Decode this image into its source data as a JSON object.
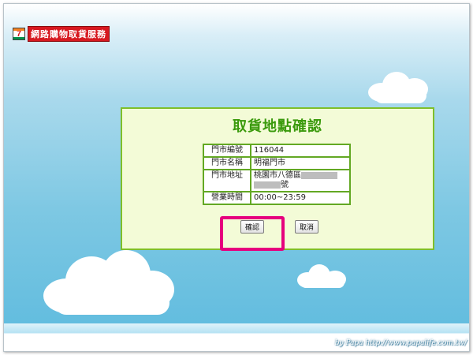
{
  "brand": {
    "logo_mark": "7",
    "logo_text": "網路購物取貨服務"
  },
  "panel": {
    "title": "取貨地點確認",
    "rows": [
      {
        "label": "門市編號",
        "value": "116044"
      },
      {
        "label": "門市名稱",
        "value": "明福門市"
      },
      {
        "label": "門市地址",
        "value_prefix": "桃園市八德區",
        "value_suffix": "號"
      },
      {
        "label": "營業時間",
        "value": "00:00~23:59"
      }
    ]
  },
  "buttons": {
    "confirm_label": "確認",
    "cancel_label": "取消"
  },
  "watermark": "by Papa http://www.papalife.com.tw/",
  "colors": {
    "panel_border": "#7fbf2a",
    "panel_bg": "#f3fbd7",
    "title": "#3a9a0c",
    "highlight": "#e6007e",
    "brand_red": "#d71920"
  }
}
